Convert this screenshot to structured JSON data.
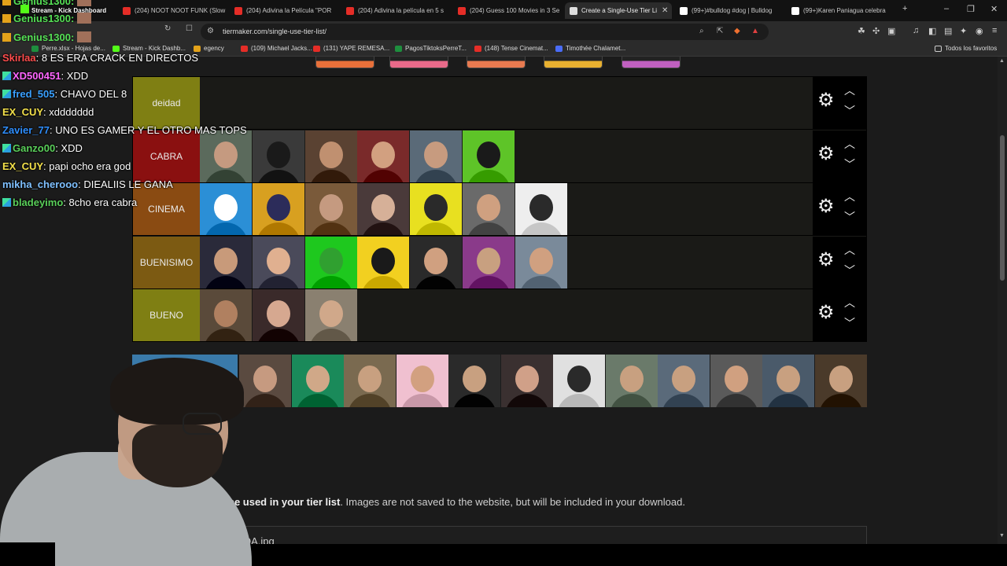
{
  "browser": {
    "tabs": [
      {
        "label": "(204) NOOT NOOT FUNK (Slow",
        "favicon_color": "#e52d27"
      },
      {
        "label": "(204) Adivina la Película \"POR",
        "favicon_color": "#e52d27"
      },
      {
        "label": "(204) Adivina la película en 5 s",
        "favicon_color": "#e52d27"
      },
      {
        "label": "(204) Guess 100 Movies in 3 Se",
        "favicon_color": "#e52d27"
      },
      {
        "label": "Create a Single-Use Tier Li",
        "favicon_color": "#dddddd",
        "active": true
      },
      {
        "label": "(99+)#bulldog #dog | Bulldog",
        "favicon_color": "#ffffff"
      },
      {
        "label": "(99+)Karen Paniagua celebra",
        "favicon_color": "#ffffff"
      }
    ],
    "new_tab_icon": "plus-icon",
    "url": "tiermaker.com/single-use-tier-list/",
    "bookmarks": [
      {
        "label": "Perre.xlsx - Hojas de...",
        "color": "#1e8e3e"
      },
      {
        "label": "Stream - Kick Dashb...",
        "color": "#53fc18"
      },
      {
        "label": "egency",
        "color": "#e3a21a"
      },
      {
        "label": "(109) Michael Jacks...",
        "color": "#e52d27"
      },
      {
        "label": "(131) YAPE REMESA...",
        "color": "#e52d27"
      },
      {
        "label": "PagosTiktoksPerreT...",
        "color": "#1e8e3e"
      },
      {
        "label": "(148) Tense Cinemat...",
        "color": "#e52d27"
      },
      {
        "label": "Timothée Chalamet...",
        "color": "#4a6cf7"
      }
    ],
    "all_bookmarks": "Todos los favoritos"
  },
  "overlay": {
    "header_lines": [
      {
        "user": "Genius1300:",
        "color": "#55e055"
      },
      {
        "user": "Stream - Kick Dashboard",
        "color": "#ffffff"
      },
      {
        "user": "Genius1300:",
        "color": "#55e055"
      },
      {
        "user": "Genius1300:",
        "color": "#55e055"
      }
    ],
    "chat": [
      {
        "user": "Skirlaa",
        "sep": ":",
        "msg": " 8 ES ERA CRACK EN DIRECTOS",
        "color": "#ff4d4d",
        "badge": false
      },
      {
        "user": "XD500451",
        "sep": ":",
        "msg": " XDD",
        "color": "#ff66ff",
        "badge": true
      },
      {
        "user": "fred_505",
        "sep": ":",
        "msg": " CHAVO DEL 8",
        "color": "#3aa0ff",
        "badge": true
      },
      {
        "user": "EX_CUY",
        "sep": ":",
        "msg": " xddddddd",
        "color": "#f3e04a",
        "badge": false
      },
      {
        "user": "Zavier_77",
        "sep": ":",
        "msg": " UNO ES GAMER Y EL OTRO MAS TOPS",
        "color": "#2f8fff",
        "badge": false
      },
      {
        "user": "Ganzo00",
        "sep": ":",
        "msg": " XDD",
        "color": "#5ad05a",
        "badge": true
      },
      {
        "user": "EX_CUY",
        "sep": ":",
        "msg": " papi ocho era god",
        "color": "#f3e04a",
        "badge": false
      },
      {
        "user": "mikha_cherooo",
        "sep": ":",
        "msg": " DIEALIIS LE GANA",
        "color": "#7fc0ff",
        "badge": false
      },
      {
        "user": "bladeyimo",
        "sep": ":",
        "msg": " 8cho era cabra",
        "color": "#5ad05a",
        "badge": true
      }
    ]
  },
  "tierlist": {
    "tiers": [
      {
        "label": "deidad",
        "color": "#7f7f13",
        "items": 0
      },
      {
        "label": "CABRA",
        "color": "#8a1010",
        "items": 6
      },
      {
        "label": "CINEMA",
        "color": "#8a4b12",
        "items": 7
      },
      {
        "label": "BUENISIMO",
        "color": "#7c5a12",
        "items": 7
      },
      {
        "label": "BUENO",
        "color": "#7f7f13",
        "items": 3
      }
    ],
    "item_palettes": [
      [
        "#5b6a5c",
        "#c59a80"
      ],
      [
        "#3a3a3a",
        "#1a1a1a"
      ],
      [
        "#5a4232",
        "#c09070"
      ],
      [
        "#7a2a2a",
        "#d2a080"
      ],
      [
        "#5a6a78",
        "#c79b7f"
      ],
      [
        "#5ec428",
        "#1a1a1a"
      ],
      [
        "#2b8fd6",
        "#ffffff"
      ],
      [
        "#d8a020",
        "#2c2c5a"
      ],
      [
        "#7a5a3a",
        "#c59a80"
      ],
      [
        "#4a3a3a",
        "#d6b098"
      ],
      [
        "#e8e020",
        "#2a2a2a"
      ],
      [
        "#6a6a6a",
        "#cfa080"
      ],
      [
        "#eeeeee",
        "#2a2a2a"
      ],
      [
        "#2a2a3a",
        "#c89a7a"
      ],
      [
        "#4a4a5a",
        "#e0b090"
      ],
      [
        "#1ec81e",
        "#30a030"
      ],
      [
        "#f2d020",
        "#1a1a1a"
      ],
      [
        "#2a2a2a",
        "#d0a080"
      ],
      [
        "#8a3a8a",
        "#c8a080"
      ],
      [
        "#7a8a9a",
        "#d0a080"
      ],
      [
        "#5a4a3a",
        "#b08060"
      ],
      [
        "#3a2a2a",
        "#d6a890"
      ],
      [
        "#8a8070",
        "#d0a88a"
      ]
    ],
    "pool_palettes": [
      [
        "#3a7aaa",
        "#c8a080"
      ],
      [
        "#5a4a40",
        "#c69a80"
      ],
      [
        "#1a8a5a",
        "#d0a888"
      ],
      [
        "#7a6a50",
        "#c8a080"
      ],
      [
        "#f0c0d0",
        "#d2a080"
      ],
      [
        "#2a2a2a",
        "#c8a080"
      ],
      [
        "#3a3030",
        "#d0a088"
      ],
      [
        "#e0e0e0",
        "#2a2a2a"
      ],
      [
        "#6a7a6a",
        "#c8a080"
      ],
      [
        "#5a6a7a",
        "#c8a080"
      ],
      [
        "#5a5a5a",
        "#d0a080"
      ],
      [
        "#4a5a6a",
        "#c8a080"
      ],
      [
        "#4a3a2a",
        "#c8a080"
      ]
    ],
    "control_icons": {
      "settings": "gear-icon",
      "up": "chevron-up-icon",
      "down": "chevron-down-icon"
    }
  },
  "upload": {
    "note_bold": "be used in your tier list",
    "note_rest": ". Images are not saved to the website, but will be included in your download.",
    "file_partial": "OA.jpg"
  }
}
